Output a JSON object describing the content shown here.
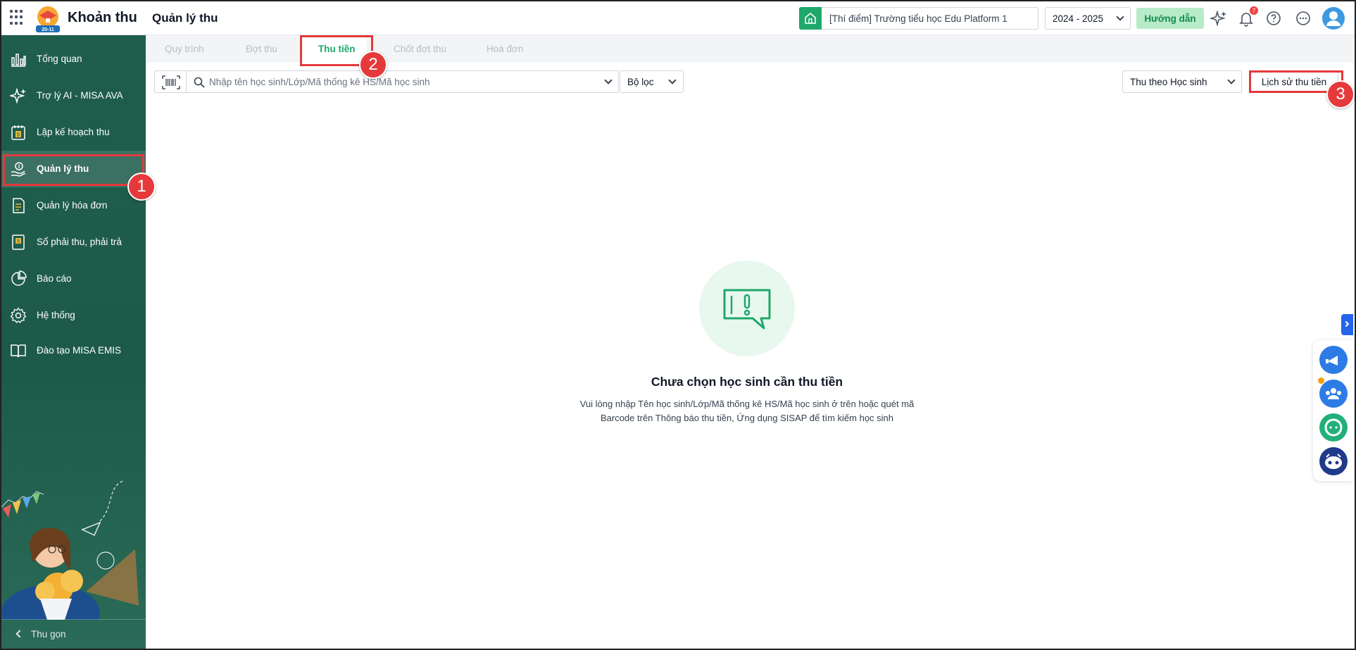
{
  "app": {
    "brand": "Khoản thu",
    "logo_text": "20-11",
    "page_title": "Quản lý thu"
  },
  "topbar": {
    "school": "[Thí điểm] Trường tiểu học Edu Platform 1",
    "year": "2024 - 2025",
    "guide_label": "Hướng dẫn",
    "notification_count": "7",
    "icons": [
      "apps-grid-icon",
      "school-icon",
      "sparkle-icon",
      "bell-icon",
      "help-icon",
      "more-icon",
      "user-avatar"
    ]
  },
  "sidebar": {
    "items": [
      {
        "label": "Tổng quan",
        "icon": "chart-icon"
      },
      {
        "label": "Trợ lý AI - MISA AVA",
        "icon": "sparkle-icon"
      },
      {
        "label": "Lập kế hoạch thu",
        "icon": "calendar-money-icon"
      },
      {
        "label": "Quản lý thu",
        "icon": "hand-money-icon",
        "active": true
      },
      {
        "label": "Quản lý hóa đơn",
        "icon": "invoice-icon"
      },
      {
        "label": "Sổ phải thu, phải trả",
        "icon": "ledger-icon"
      },
      {
        "label": "Báo cáo",
        "icon": "pie-chart-icon"
      },
      {
        "label": "Hệ thống",
        "icon": "gear-icon"
      },
      {
        "label": "Đào tạo MISA EMIS",
        "icon": "book-icon"
      }
    ],
    "collapse_label": "Thu gọn"
  },
  "tabs": [
    {
      "label": "Quy trình",
      "active": false
    },
    {
      "label": "Đợt thu",
      "active": false
    },
    {
      "label": "Thu tiền",
      "active": true
    },
    {
      "label": "Chốt đợt thu",
      "active": false
    },
    {
      "label": "Hoá đơn",
      "active": false
    }
  ],
  "toolbar": {
    "search_placeholder": "Nhập tên học sinh/Lớp/Mã thống kê HS/Mã học sinh",
    "filter_label": "Bộ lọc",
    "mode_label": "Thu theo Học sinh",
    "history_label": "Lịch sử thu tiền"
  },
  "empty_state": {
    "title": "Chưa chọn học sinh cần thu tiền",
    "desc_line1": "Vui lòng nhập Tên học sinh/Lớp/Mã thống kê HS/Mã học sinh ở trên hoặc quét mã",
    "desc_line2": "Barcode trên Thông báo thu tiền, Ứng dụng SISAP để tìm kiếm học sinh"
  },
  "annotations": [
    "1",
    "2",
    "3"
  ],
  "colors": {
    "sidebar_bg": "#1f5d4c",
    "accent_green": "#1ea86b",
    "annotation_red": "#e5393b"
  }
}
